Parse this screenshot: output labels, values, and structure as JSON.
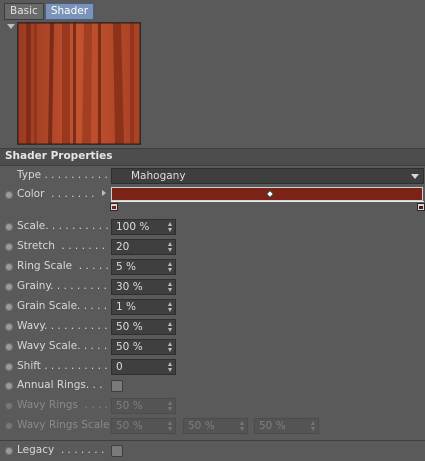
{
  "tabs": [
    {
      "label": "Basic",
      "active": false
    },
    {
      "label": "Shader",
      "active": true
    }
  ],
  "preview": {
    "description": ""
  },
  "section": {
    "title": "Shader Properties"
  },
  "fields": {
    "type": {
      "label": "Type . . . . . . . . . .",
      "value": "Mahogany"
    },
    "color": {
      "label": "Color  . . . . . . .",
      "gradient_color": "#7b2316"
    },
    "scale": {
      "label": "Scale. . . . . . . . . .",
      "value": "100 %"
    },
    "stretch": {
      "label": "Stretch  . . . . . . .",
      "value": "20"
    },
    "ring_scale": {
      "label": "Ring Scale  . . . . .",
      "value": "5 %"
    },
    "grainy": {
      "label": "Grainy. . . . . . . . .",
      "value": "30 %"
    },
    "grain_scale": {
      "label": "Grain Scale. . . . .",
      "value": "1 %"
    },
    "wavy": {
      "label": "Wavy. . . . . . . . . .",
      "value": "50 %"
    },
    "wavy_scale": {
      "label": "Wavy Scale. . . . .",
      "value": "50 %"
    },
    "shift": {
      "label": "Shift . . . . . . . . . .",
      "value": "0"
    },
    "annual_rings": {
      "label": "Annual Rings. . .",
      "checked": false
    },
    "wavy_rings": {
      "label": "Wavy Rings  . . . .",
      "value": "50 %",
      "disabled": true
    },
    "wavy_rings_scale": {
      "label": "Wavy Rings Scale",
      "values": [
        "50 %",
        "50 %",
        "50 %"
      ],
      "disabled": true
    },
    "legacy": {
      "label": "Legacy  . . . . . . .",
      "checked": false
    }
  },
  "colors": {
    "accent_tab": "#7a93b8",
    "wood_base": "#b54a2c",
    "wood_dark": "#7d2b17"
  }
}
